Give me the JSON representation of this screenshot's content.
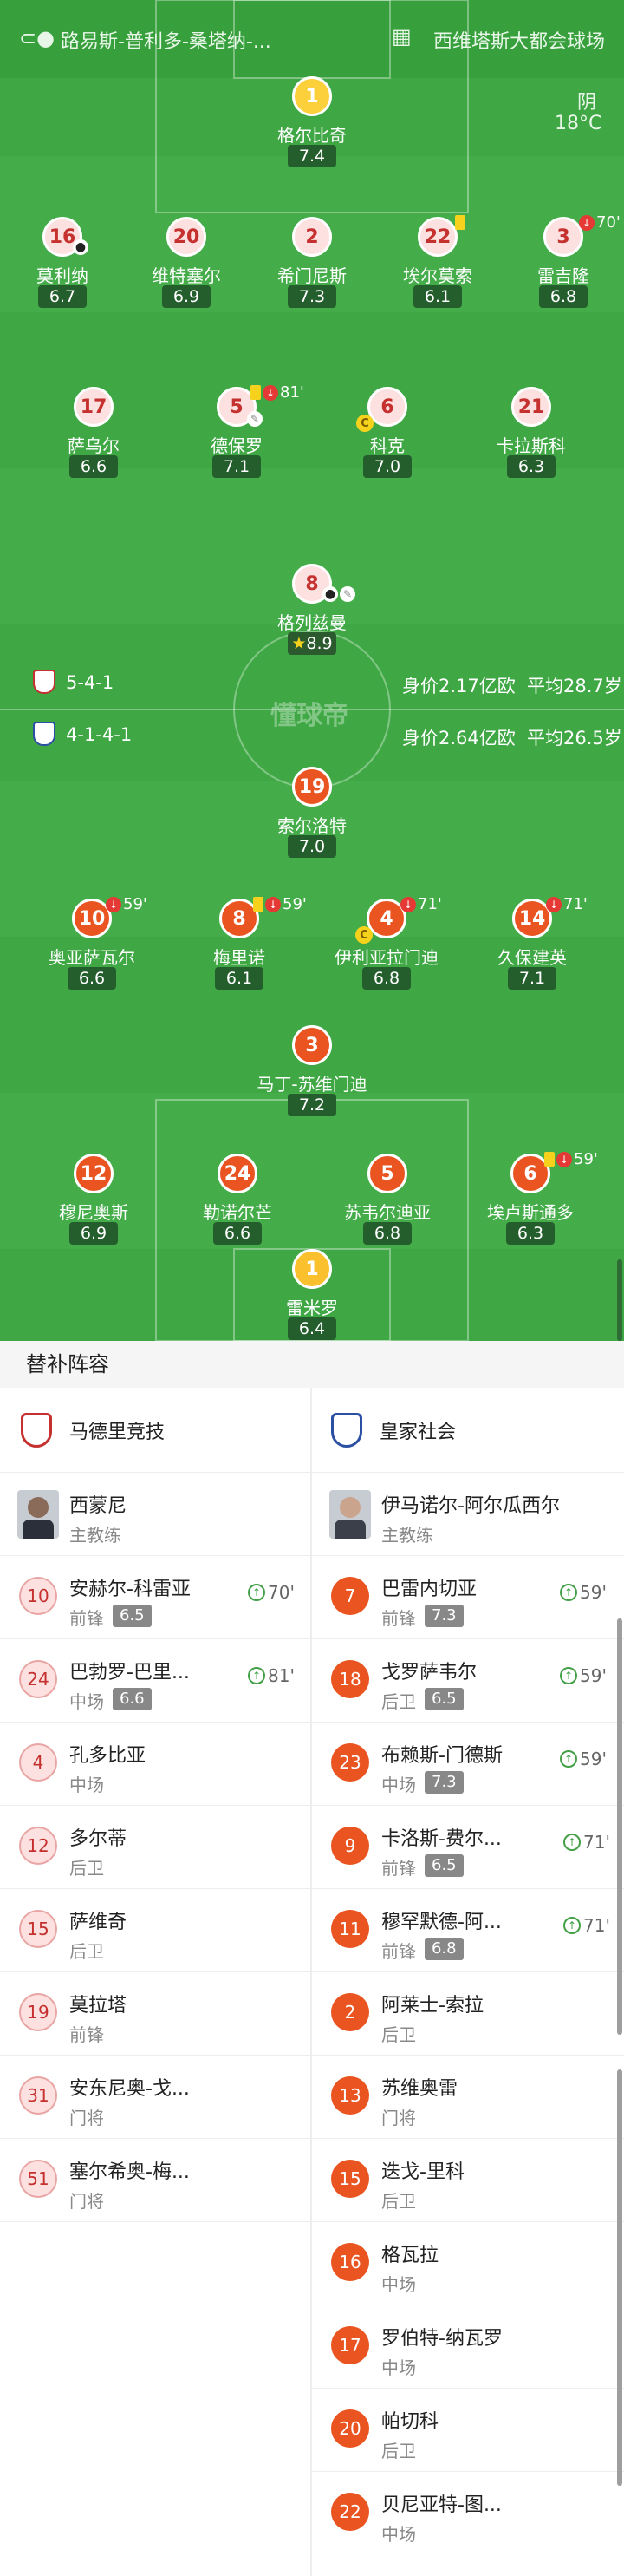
{
  "header": {
    "referee": "路易斯-普利多-桑塔纳-...",
    "stadium": "西维塔斯大都会球场",
    "weather": "阴",
    "temperature": "18°C"
  },
  "home_team": {
    "name": "马德里竞技",
    "formation": "5-4-1",
    "value": "身价2.17亿欧",
    "age": "平均28.7岁"
  },
  "away_team": {
    "name": "皇家社会",
    "formation": "4-1-4-1",
    "value": "身价2.64亿欧",
    "age": "平均26.5岁"
  },
  "watermark": "懂球帝",
  "home_players": [
    {
      "num": "1",
      "name": "格尔比奇",
      "rating": "7.4"
    },
    {
      "num": "16",
      "name": "莫利纳",
      "rating": "6.7"
    },
    {
      "num": "20",
      "name": "维特塞尔",
      "rating": "6.9"
    },
    {
      "num": "2",
      "name": "希门尼斯",
      "rating": "7.3"
    },
    {
      "num": "22",
      "name": "埃尔莫索",
      "rating": "6.1"
    },
    {
      "num": "3",
      "name": "雷吉隆",
      "rating": "6.8",
      "sub_time": "70'"
    },
    {
      "num": "17",
      "name": "萨乌尔",
      "rating": "6.6"
    },
    {
      "num": "5",
      "name": "德保罗",
      "rating": "7.1",
      "sub_time": "81'"
    },
    {
      "num": "6",
      "name": "科克",
      "rating": "7.0"
    },
    {
      "num": "21",
      "name": "卡拉斯科",
      "rating": "6.3"
    },
    {
      "num": "8",
      "name": "格列兹曼",
      "rating": "8.9"
    }
  ],
  "away_players": [
    {
      "num": "19",
      "name": "索尔洛特",
      "rating": "7.0"
    },
    {
      "num": "10",
      "name": "奥亚萨瓦尔",
      "rating": "6.6",
      "sub_time": "59'"
    },
    {
      "num": "8",
      "name": "梅里诺",
      "rating": "6.1",
      "sub_time": "59'"
    },
    {
      "num": "4",
      "name": "伊利亚拉门迪",
      "rating": "6.8",
      "sub_time": "71'"
    },
    {
      "num": "14",
      "name": "久保建英",
      "rating": "7.1",
      "sub_time": "71'"
    },
    {
      "num": "3",
      "name": "马丁-苏维门迪",
      "rating": "7.2"
    },
    {
      "num": "12",
      "name": "穆尼奥斯",
      "rating": "6.9"
    },
    {
      "num": "24",
      "name": "勒诺尔芒",
      "rating": "6.6"
    },
    {
      "num": "5",
      "name": "苏韦尔迪亚",
      "rating": "6.8"
    },
    {
      "num": "6",
      "name": "埃卢斯通多",
      "rating": "6.3",
      "sub_time": "59'"
    },
    {
      "num": "1",
      "name": "雷米罗",
      "rating": "6.4"
    }
  ],
  "bench": {
    "title": "替补阵容",
    "home_coach": {
      "name": "西蒙尼",
      "role": "主教练"
    },
    "away_coach": {
      "name": "伊马诺尔-阿尔瓜西尔",
      "role": "主教练"
    },
    "home": [
      {
        "num": "10",
        "name": "安赫尔-科雷亚",
        "pos": "前锋",
        "rating": "6.5",
        "time": "70'"
      },
      {
        "num": "24",
        "name": "巴勃罗-巴里...",
        "pos": "中场",
        "rating": "6.6",
        "time": "81'"
      },
      {
        "num": "4",
        "name": "孔多比亚",
        "pos": "中场"
      },
      {
        "num": "12",
        "name": "多尔蒂",
        "pos": "后卫"
      },
      {
        "num": "15",
        "name": "萨维奇",
        "pos": "后卫"
      },
      {
        "num": "19",
        "name": "莫拉塔",
        "pos": "前锋"
      },
      {
        "num": "31",
        "name": "安东尼奥-戈...",
        "pos": "门将"
      },
      {
        "num": "51",
        "name": "塞尔希奥-梅...",
        "pos": "门将"
      }
    ],
    "away": [
      {
        "num": "7",
        "name": "巴雷内切亚",
        "pos": "前锋",
        "rating": "7.3",
        "time": "59'"
      },
      {
        "num": "18",
        "name": "戈罗萨韦尔",
        "pos": "后卫",
        "rating": "6.5",
        "time": "59'"
      },
      {
        "num": "23",
        "name": "布赖斯-门德斯",
        "pos": "中场",
        "rating": "7.3",
        "time": "59'"
      },
      {
        "num": "9",
        "name": "卡洛斯-费尔...",
        "pos": "前锋",
        "rating": "6.5",
        "time": "71'"
      },
      {
        "num": "11",
        "name": "穆罕默德-阿...",
        "pos": "前锋",
        "rating": "6.8",
        "time": "71'"
      },
      {
        "num": "2",
        "name": "阿莱士-索拉",
        "pos": "后卫"
      },
      {
        "num": "13",
        "name": "苏维奥雷",
        "pos": "门将"
      },
      {
        "num": "15",
        "name": "迭戈-里科",
        "pos": "后卫"
      },
      {
        "num": "16",
        "name": "格瓦拉",
        "pos": "中场"
      },
      {
        "num": "17",
        "name": "罗伯特-纳瓦罗",
        "pos": "中场"
      },
      {
        "num": "20",
        "name": "帕切科",
        "pos": "后卫"
      },
      {
        "num": "22",
        "name": "贝尼亚特-图...",
        "pos": "中场"
      }
    ]
  },
  "colors": {
    "pitch": "#3fa845",
    "home": "#c4312e",
    "away": "#e95420",
    "gk": "#fbd03a"
  }
}
